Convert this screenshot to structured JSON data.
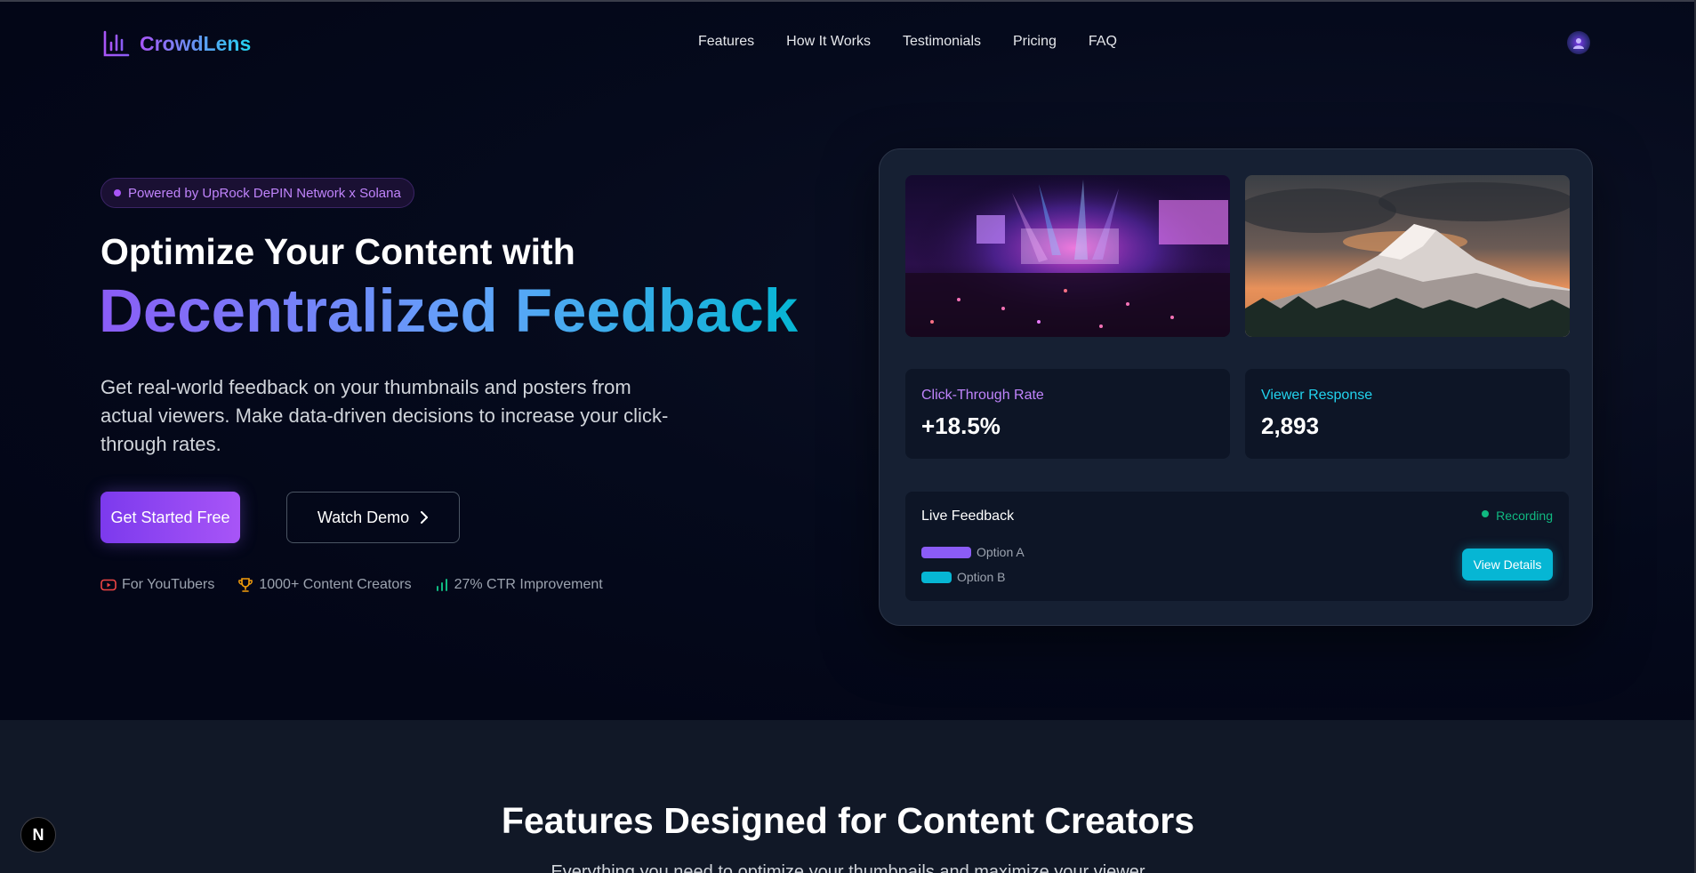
{
  "brand": {
    "name": "CrowdLens",
    "logo_icon": "bar-chart-icon"
  },
  "nav": {
    "links": [
      "Features",
      "How It Works",
      "Testimonials",
      "Pricing",
      "FAQ"
    ]
  },
  "hero": {
    "badge": "Powered by UpRock DePIN Network x Solana",
    "title_line1": "Optimize Your Content with",
    "title_line2": "Decentralized Feedback",
    "description": "Get real-world feedback on your thumbnails and posters from actual viewers. Make data-driven decisions to increase your click-through rates.",
    "cta_primary": "Get Started Free",
    "cta_secondary": "Watch Demo",
    "stats": [
      {
        "icon": "youtube-icon",
        "label": "For YouTubers",
        "color": "#ef4444"
      },
      {
        "icon": "trophy-icon",
        "label": "1000+ Content Creators",
        "color": "#f59e0b"
      },
      {
        "icon": "bar-chart-icon",
        "label": "27% CTR Improvement",
        "color": "#10b981"
      }
    ]
  },
  "preview": {
    "thumbnails": [
      "concert-image",
      "mountain-image"
    ],
    "metrics": [
      {
        "label": "Click-Through Rate",
        "value": "+18.5%",
        "color": "#c084fc"
      },
      {
        "label": "Viewer Response",
        "value": "2,893",
        "color": "#22d3ee"
      }
    ],
    "live": {
      "title": "Live Feedback",
      "status": "Recording",
      "options": [
        {
          "label": "Option A",
          "color": "#8b5cf6",
          "share": 0.62
        },
        {
          "label": "Option B",
          "color": "#06b6d4",
          "share": 0.38
        }
      ],
      "button": "View Details"
    }
  },
  "features": {
    "title": "Features Designed for Content Creators",
    "subtitle": "Everything you need to optimize your thumbnails and maximize your viewer"
  },
  "dev_badge": "N",
  "colors": {
    "accent_purple": "#8b5cf6",
    "accent_cyan": "#06b6d4",
    "background": "#030617"
  }
}
